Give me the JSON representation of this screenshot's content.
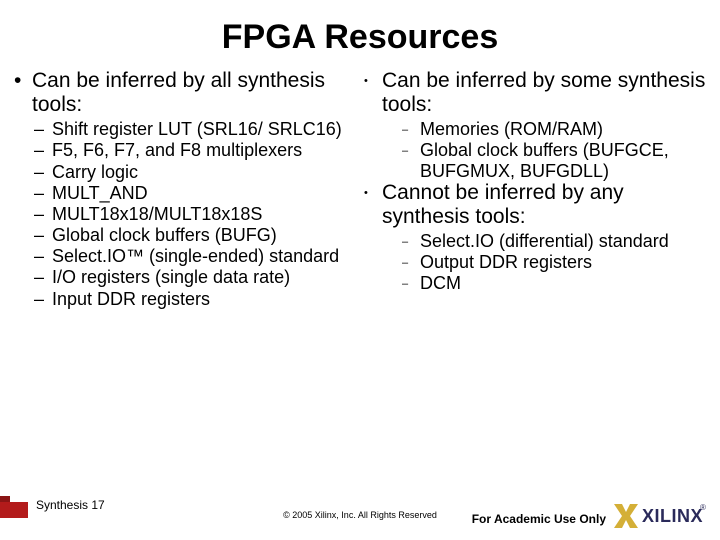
{
  "title": "FPGA Resources",
  "left": {
    "heading": "Can be inferred by all synthesis tools:",
    "items": [
      "Shift register LUT (SRL16/ SRLC16)",
      "F5, F6, F7, and F8 multiplexers",
      "Carry logic",
      "MULT_AND",
      "MULT18x18/MULT18x18S",
      "Global clock buffers (BUFG)",
      "Select.IO™ (single-ended) standard",
      "I/O registers (single data rate)",
      "Input DDR registers"
    ]
  },
  "right": {
    "groups": [
      {
        "heading": "Can be inferred by some synthesis tools:",
        "items": [
          "Memories (ROM/RAM)",
          "Global clock buffers (BUFGCE, BUFGMUX, BUFGDLL)"
        ]
      },
      {
        "heading": "Cannot be inferred by any synthesis tools:",
        "items": [
          "Select.IO (differential) standard",
          "Output DDR registers",
          "DCM"
        ]
      }
    ]
  },
  "footer": {
    "label": "Synthesis  17",
    "copyright": "© 2005 Xilinx, Inc. All Rights Reserved",
    "academic": "For Academic Use Only",
    "logo_text": "XILINX",
    "logo_reg": "®"
  },
  "bullets": {
    "lvl1_left": "•",
    "lvl2": "–",
    "lvl1_right": "•",
    "lvl3": "–"
  }
}
